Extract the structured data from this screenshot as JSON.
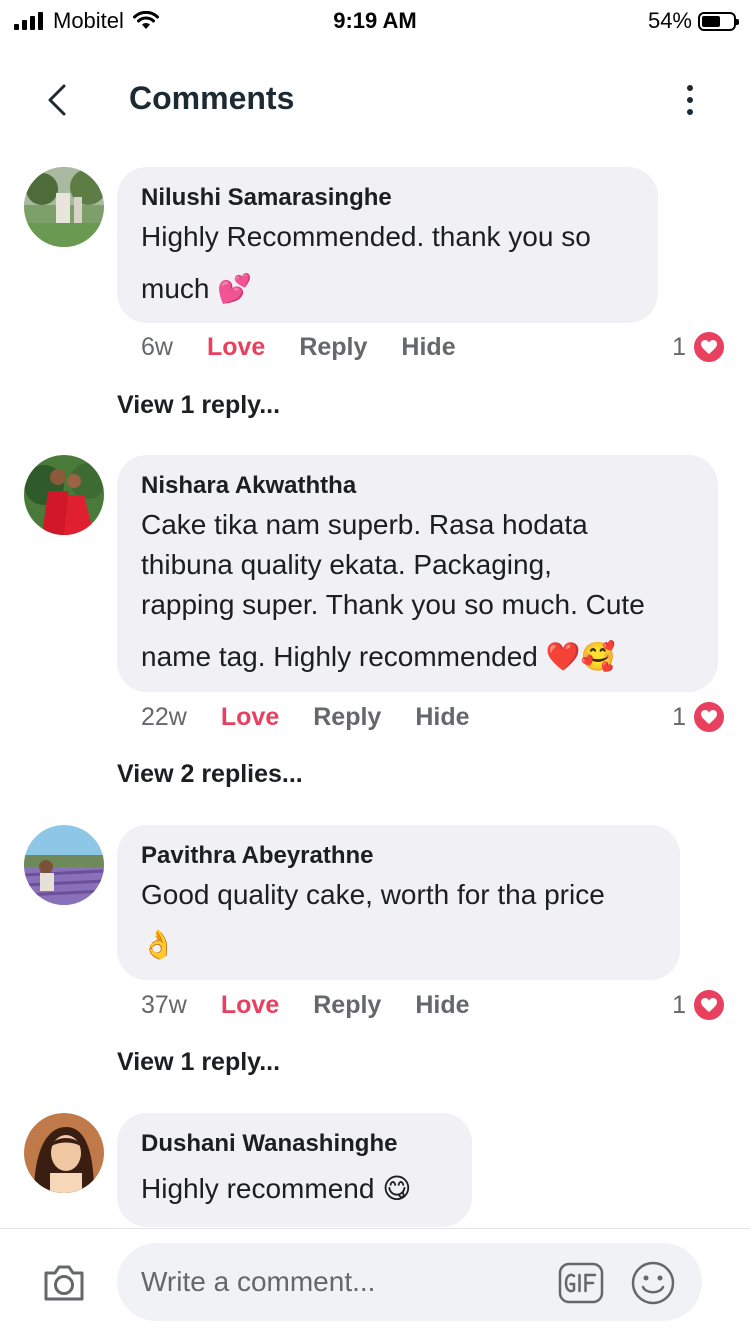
{
  "status_bar": {
    "carrier": "Mobitel",
    "time": "9:19 AM",
    "battery": "54%"
  },
  "header": {
    "title": "Comments"
  },
  "comments": [
    {
      "author": "Nilushi Samarasinghe",
      "lines": [
        "Highly Recommended. thank you so",
        "much 💕"
      ],
      "age": "6w",
      "love": "Love",
      "reply": "Reply",
      "hide": "Hide",
      "reaction_count": "1",
      "view_replies": "View 1 reply..."
    },
    {
      "author": "Nishara Akwaththa",
      "lines": [
        "Cake tika nam superb. Rasa hodata",
        "thibuna quality ekata. Packaging,",
        "rapping super. Thank you so much. Cute",
        "name tag. Highly recommended ❤️🥰"
      ],
      "age": "22w",
      "love": "Love",
      "reply": "Reply",
      "hide": "Hide",
      "reaction_count": "1",
      "view_replies": "View 2 replies..."
    },
    {
      "author": "Pavithra Abeyrathne",
      "lines": [
        "Good quality cake, worth for tha price",
        "👌"
      ],
      "age": "37w",
      "love": "Love",
      "reply": "Reply",
      "hide": "Hide",
      "reaction_count": "1",
      "view_replies": "View 1 reply..."
    },
    {
      "author": "Dushani Wanashinghe",
      "lines": [
        "Highly recommend 😋"
      ]
    }
  ],
  "composer": {
    "placeholder": "Write a comment..."
  }
}
